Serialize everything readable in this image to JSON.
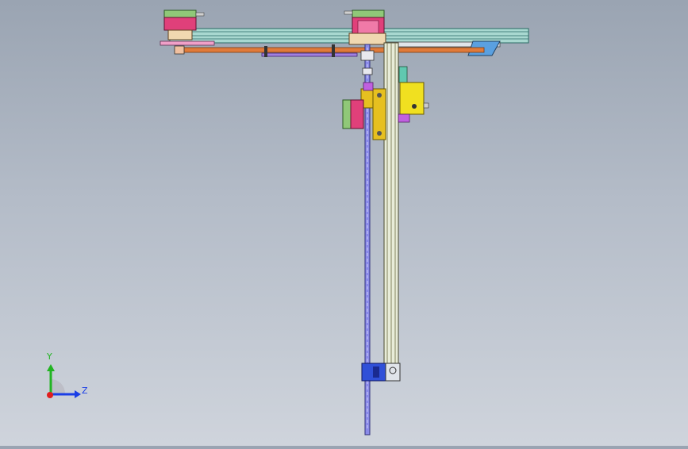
{
  "viewport": {
    "background_top": "#9aa4b2",
    "background_bottom": "#cfd4dc"
  },
  "triad": {
    "y_label": "Y",
    "z_label": "Z",
    "y_color": "#22b422",
    "z_color": "#1a3ee6",
    "x_color": "#e01e1e"
  },
  "model": {
    "colors": {
      "rail": "#a8d8d0",
      "rail_dark": "#2a6a64",
      "motor_body": "#e0407a",
      "motor_cap": "#90c878",
      "carriage": "#e6c020",
      "plate_orange": "#e07a3a",
      "shaft": "#8a8ae8",
      "base_block": "#3050d8",
      "tan": "#f0d8b0"
    }
  }
}
